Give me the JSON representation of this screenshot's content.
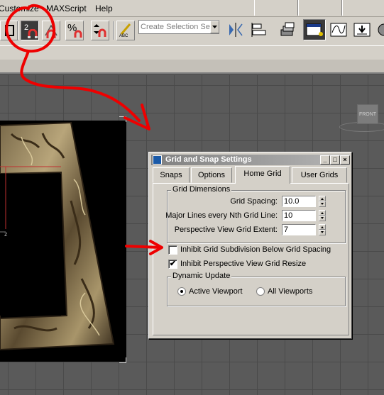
{
  "menubar": {
    "items": [
      "Customize",
      "MAXScript",
      "Help"
    ]
  },
  "toolbar": {
    "snap_2d_label": "2",
    "percent_label": "%",
    "abc_label": "ABC",
    "selection_set_placeholder": "Create Selection Se"
  },
  "viewport": {
    "cube_label": "FRONT",
    "axis_label": "z"
  },
  "dialog": {
    "title": "Grid and Snap Settings",
    "tabs": [
      "Snaps",
      "Options",
      "Home Grid",
      "User Grids"
    ],
    "active_tab": "Home Grid",
    "grid_dimensions": {
      "label": "Grid Dimensions",
      "grid_spacing_label": "Grid Spacing:",
      "grid_spacing_value": "10.0",
      "major_lines_label": "Major Lines every Nth Grid Line:",
      "major_lines_value": "10",
      "perspective_extent_label": "Perspective View Grid Extent:",
      "perspective_extent_value": "7"
    },
    "inhibit_subdivision_label": "Inhibit Grid Subdivision Below Grid Spacing",
    "inhibit_subdivision_checked": false,
    "inhibit_resize_label": "Inhibit Perspective View Grid Resize",
    "inhibit_resize_checked": true,
    "dynamic_update": {
      "label": "Dynamic Update",
      "active_viewport_label": "Active Viewport",
      "all_viewports_label": "All Viewports",
      "selected": "Active Viewport"
    }
  },
  "colors": {
    "annotation": "#ee0000",
    "dialog_bg": "#d4d0c8",
    "viewport_bg": "#5a5a5a"
  }
}
